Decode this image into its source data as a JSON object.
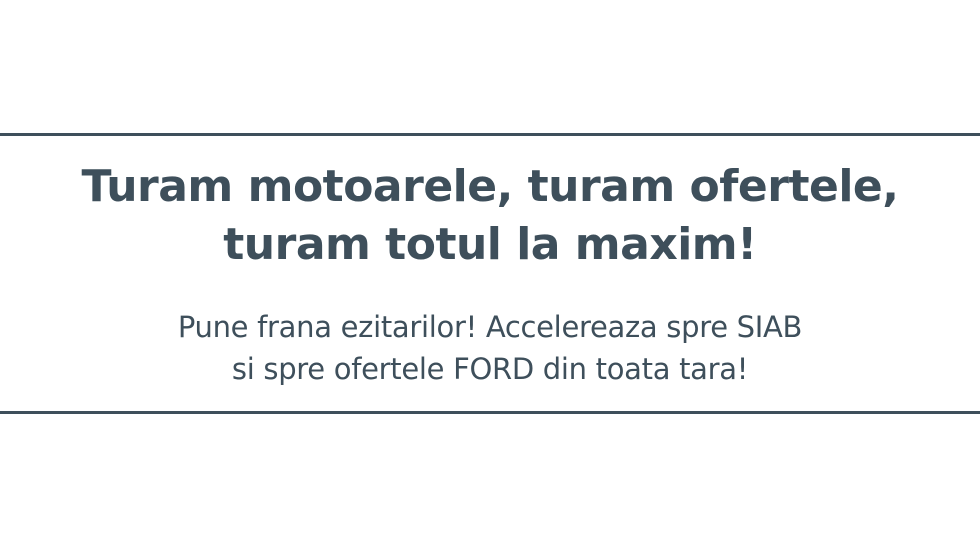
{
  "banner": {
    "headline_line1": "Turam motoarele, turam ofertele,",
    "headline_line2": "turam totul la maxim!",
    "subline_line1": "Pune frana ezitarilor! Accelereaza spre SIAB",
    "subline_line2": "si spre ofertele FORD din toata tara!"
  },
  "colors": {
    "text": "#3e4f5b",
    "rule": "#3e4f5b",
    "background": "#ffffff"
  }
}
